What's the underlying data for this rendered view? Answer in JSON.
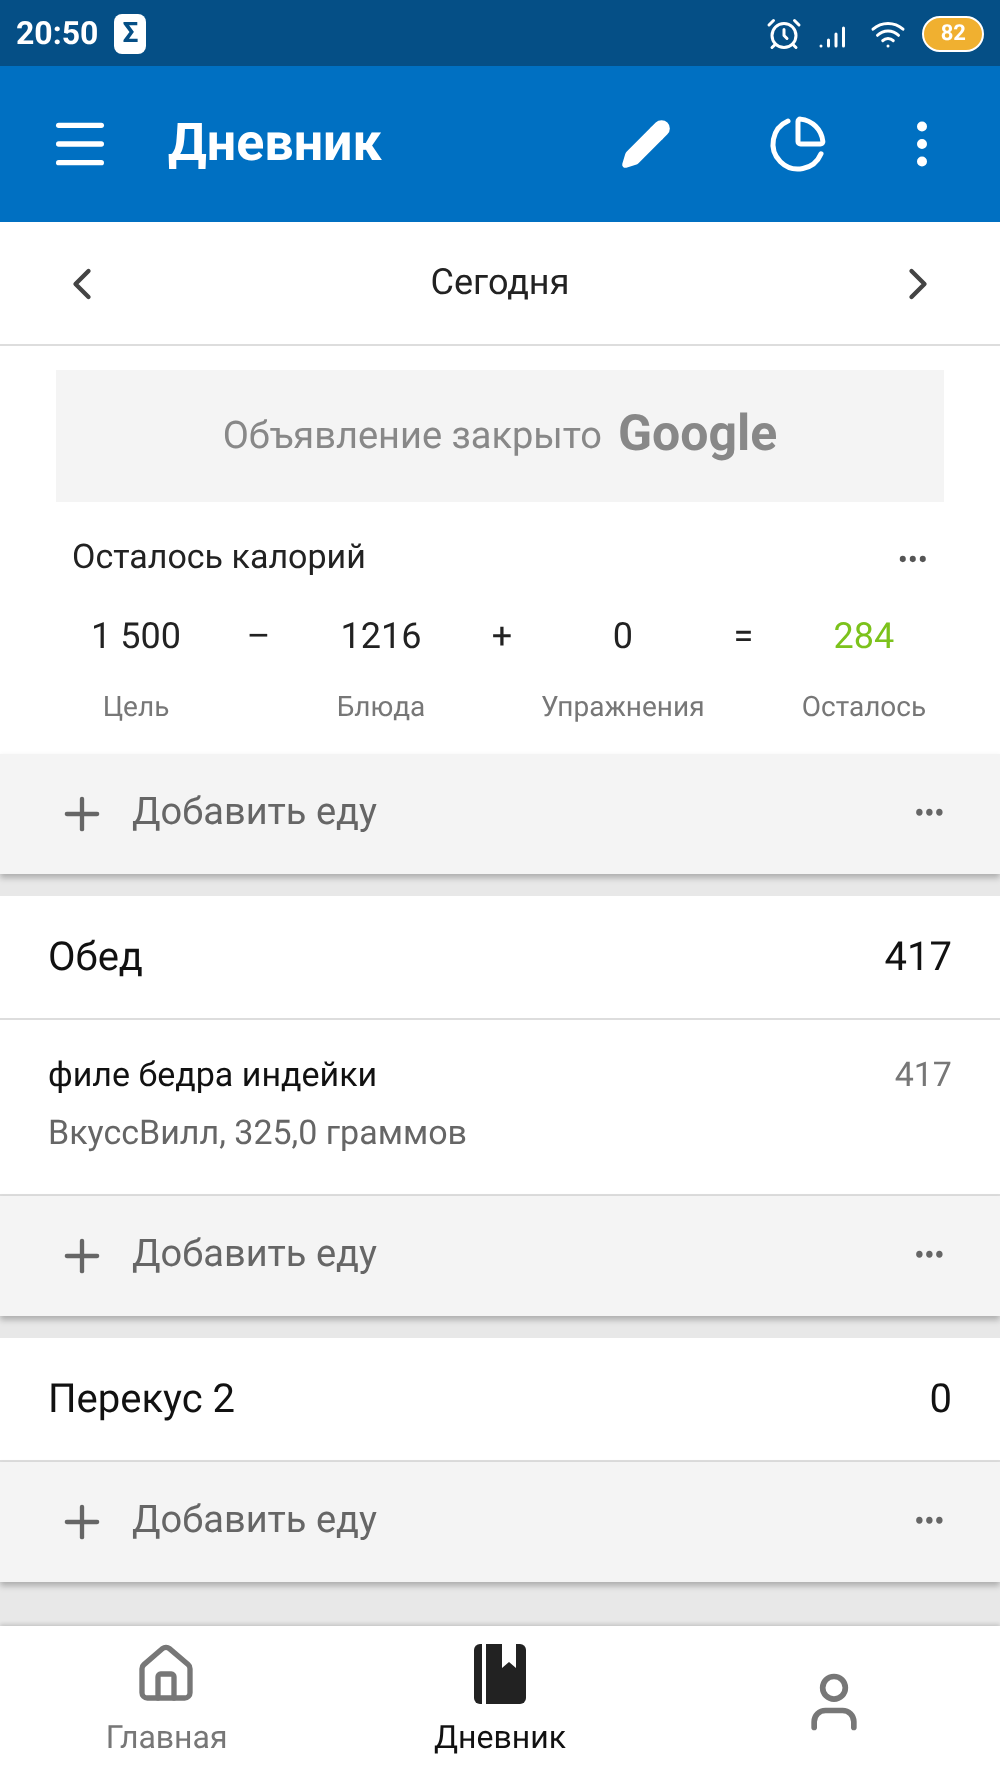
{
  "status_bar": {
    "time": "20:50",
    "app_badge": "Σ",
    "battery": "82"
  },
  "app_bar": {
    "title": "Дневник"
  },
  "date_nav": {
    "label": "Сегодня"
  },
  "ad": {
    "text": "Объявление закрыто",
    "brand": "Google"
  },
  "calories": {
    "title": "Осталось калорий",
    "more": "•••",
    "items": [
      {
        "kind": "value",
        "value": "1 500",
        "label": "Цель",
        "highlight": false
      },
      {
        "kind": "operator",
        "value": "–"
      },
      {
        "kind": "value",
        "value": "1216",
        "label": "Блюда",
        "highlight": false
      },
      {
        "kind": "operator",
        "value": "+"
      },
      {
        "kind": "value",
        "value": "0",
        "label": "Упражнения",
        "highlight": false
      },
      {
        "kind": "operator",
        "value": "="
      },
      {
        "kind": "value",
        "value": "284",
        "label": "Осталось",
        "highlight": true
      }
    ]
  },
  "sections": [
    {
      "add_label": "Добавить еду",
      "more": "•••"
    },
    {
      "title": "Обед",
      "total": "417",
      "foods": [
        {
          "name": "филе бедра индейки",
          "detail": "ВкуссВилл, 325,0 граммов",
          "calories": "417"
        }
      ],
      "add_label": "Добавить еду",
      "more": "•••"
    },
    {
      "title": "Перекус 2",
      "total": "0",
      "add_label": "Добавить еду",
      "more": "•••"
    }
  ],
  "bottom_nav": [
    {
      "kind": "home",
      "label": "Главная",
      "selected": false
    },
    {
      "kind": "diary",
      "label": "Дневник",
      "selected": true
    },
    {
      "kind": "profile",
      "selected": false
    }
  ]
}
